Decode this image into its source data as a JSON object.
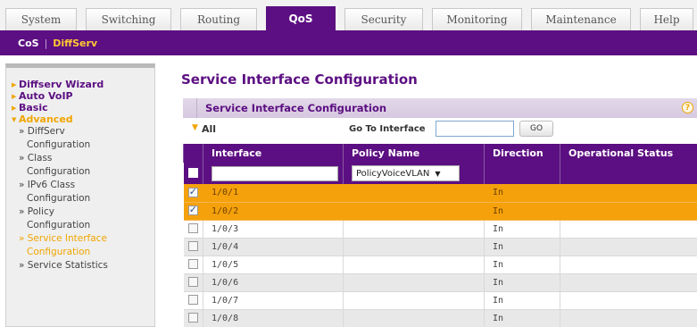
{
  "tabs": [
    {
      "label": "System",
      "active": false
    },
    {
      "label": "Switching",
      "active": false
    },
    {
      "label": "Routing",
      "active": false
    },
    {
      "label": "QoS",
      "active": true
    },
    {
      "label": "Security",
      "active": false
    },
    {
      "label": "Monitoring",
      "active": false
    },
    {
      "label": "Maintenance",
      "active": false
    },
    {
      "label": "Help",
      "active": false
    }
  ],
  "subnav": {
    "cos": "CoS",
    "separator": "|",
    "diffserv": "DiffServ"
  },
  "sidebar": {
    "top_items": [
      "Diffserv Wizard",
      "Auto VoIP",
      "Basic",
      "Advanced"
    ],
    "sub_items": [
      {
        "line1": "» DiffServ",
        "line2": "Configuration"
      },
      {
        "line1": "» Class",
        "line2": "Configuration"
      },
      {
        "line1": "» IPv6 Class",
        "line2": "Configuration"
      },
      {
        "line1": "» Policy",
        "line2": "Configuration"
      },
      {
        "line1": "» Service Interface",
        "line2": "Configuration",
        "active": true
      },
      {
        "line1": "» Service Statistics",
        "line2": ""
      }
    ]
  },
  "page_title": "Service Interface Configuration",
  "panel": {
    "title": "Service Interface Configuration",
    "help": "?"
  },
  "filter": {
    "all": "All",
    "goto_label": "Go To Interface",
    "goto_value": "",
    "go_button": "GO"
  },
  "table": {
    "headers": [
      "Interface",
      "Policy Name",
      "Direction",
      "Operational Status"
    ],
    "policy_select": "PolicyVoiceVLAN",
    "rows": [
      {
        "interface": "1/0/1",
        "policy": "",
        "direction": "In",
        "status": "",
        "checked": true
      },
      {
        "interface": "1/0/2",
        "policy": "",
        "direction": "In",
        "status": "",
        "checked": true
      },
      {
        "interface": "1/0/3",
        "policy": "",
        "direction": "In",
        "status": "",
        "checked": false
      },
      {
        "interface": "1/0/4",
        "policy": "",
        "direction": "In",
        "status": "",
        "checked": false
      },
      {
        "interface": "1/0/5",
        "policy": "",
        "direction": "In",
        "status": "",
        "checked": false
      },
      {
        "interface": "1/0/6",
        "policy": "",
        "direction": "In",
        "status": "",
        "checked": false
      },
      {
        "interface": "1/0/7",
        "policy": "",
        "direction": "In",
        "status": "",
        "checked": false
      },
      {
        "interface": "1/0/8",
        "policy": "",
        "direction": "In",
        "status": "",
        "checked": false
      }
    ]
  },
  "colors": {
    "brand": "#5c0f82",
    "accent": "#f5a10c",
    "subnav_active": "#ffc832"
  }
}
